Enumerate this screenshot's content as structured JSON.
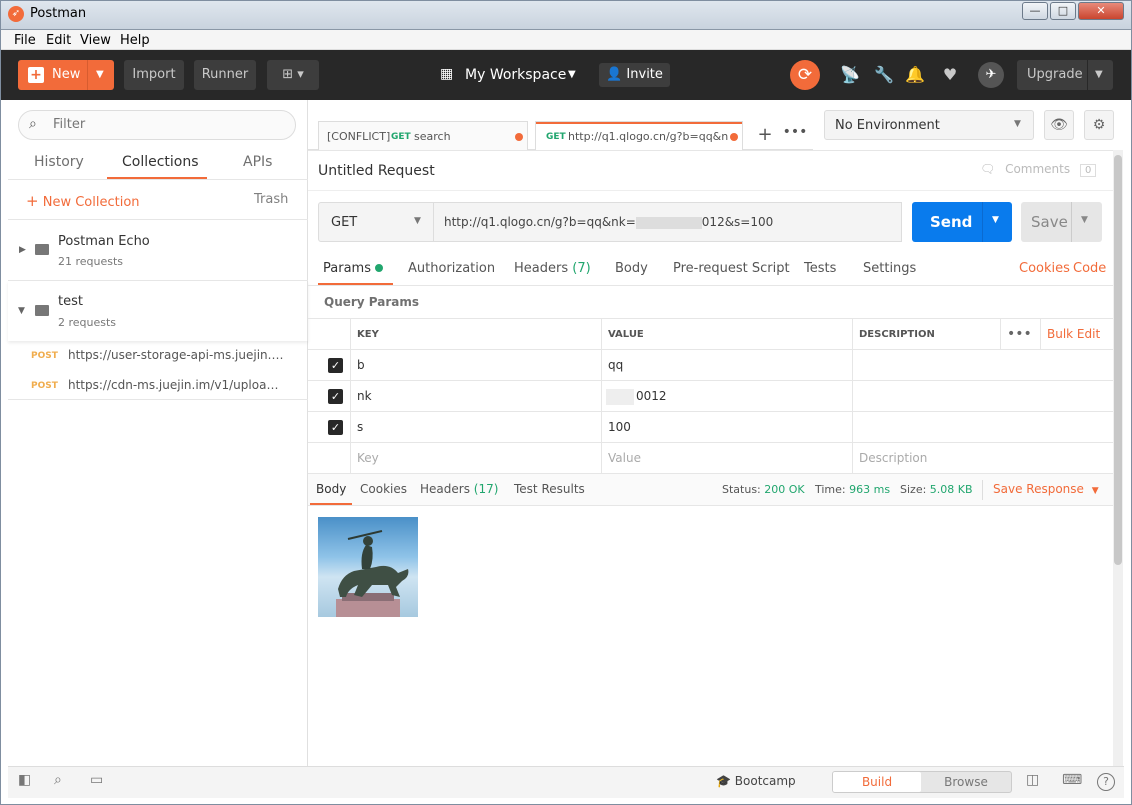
{
  "window": {
    "title": "Postman",
    "controls": [
      "—",
      "□",
      "✕"
    ]
  },
  "menu": [
    "File",
    "Edit",
    "View",
    "Help"
  ],
  "header": {
    "new_label": "New",
    "import_label": "Import",
    "runner_label": "Runner",
    "workspace_label": "My Workspace",
    "invite_label": "Invite",
    "upgrade_label": "Upgrade"
  },
  "sidebar": {
    "filter_placeholder": "Filter",
    "tabs": [
      "History",
      "Collections",
      "APIs"
    ],
    "new_collection": "New Collection",
    "trash": "Trash",
    "collections": [
      {
        "name": "Postman Echo",
        "count": "21 requests",
        "expanded": false
      },
      {
        "name": "test",
        "count": "2 requests",
        "expanded": true
      }
    ],
    "requests": [
      {
        "method": "POST",
        "url": "https://user-storage-api-ms.juejin.i..."
      },
      {
        "method": "POST",
        "url": "https://cdn-ms.juejin.im/v1/upload?..."
      }
    ]
  },
  "tabs": [
    {
      "prefix": "[CONFLICT]",
      "method": "GET",
      "label": "search"
    },
    {
      "method": "GET",
      "label": "http://q1.qlogo.cn/g?b=qq&n..."
    }
  ],
  "environment": "No Environment",
  "request": {
    "title": "Untitled Request",
    "comments_label": "Comments",
    "comments_count": "0",
    "method": "GET",
    "url_prefix": "http://q1.qlogo.cn/g?b=qq&nk=",
    "url_suffix": "012&s=100",
    "send_label": "Send",
    "save_label": "Save"
  },
  "request_tabs": {
    "params": "Params",
    "authorization": "Authorization",
    "headers": "Headers",
    "headers_count": "(7)",
    "body": "Body",
    "prerequest": "Pre-request Script",
    "tests": "Tests",
    "settings": "Settings",
    "cookies": "Cookies",
    "code": "Code"
  },
  "query_params": {
    "title": "Query Params",
    "columns": [
      "KEY",
      "VALUE",
      "DESCRIPTION"
    ],
    "bulk_edit": "Bulk Edit",
    "rows": [
      {
        "key": "b",
        "value": "qq",
        "checked": true
      },
      {
        "key": "nk",
        "value": "0012",
        "checked": true
      },
      {
        "key": "s",
        "value": "100",
        "checked": true
      }
    ],
    "placeholders": {
      "key": "Key",
      "value": "Value",
      "description": "Description"
    }
  },
  "response": {
    "tabs": {
      "body": "Body",
      "cookies": "Cookies",
      "headers": "Headers",
      "headers_count": "(17)",
      "tests": "Test Results"
    },
    "status_label": "Status:",
    "status": "200 OK",
    "time_label": "Time:",
    "time": "963 ms",
    "size_label": "Size:",
    "size": "5.08 KB",
    "save_response": "Save Response"
  },
  "footer": {
    "bootcamp": "Bootcamp",
    "build": "Build",
    "browse": "Browse"
  }
}
